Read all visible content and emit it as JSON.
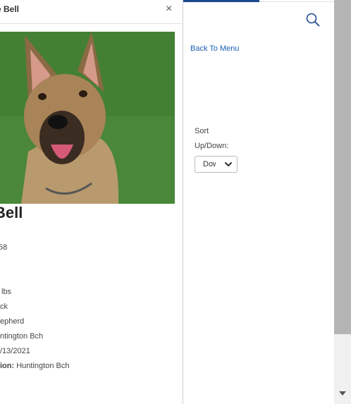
{
  "panel": {
    "title": "e Bell",
    "close_glyph": "×",
    "pet_name": "Bell",
    "id_value": "58",
    "details": [
      {
        "label": "",
        "value": "lbs"
      },
      {
        "label": "",
        "value": "ck"
      },
      {
        "label": "",
        "value": "epherd"
      },
      {
        "label": "",
        "value": "ntington Bch"
      },
      {
        "label": "",
        "value": "/13/2021"
      },
      {
        "label": "ion:",
        "value": "Huntington Bch"
      }
    ]
  },
  "sidebar": {
    "back_link": "Back To Menu",
    "sort_label_1": "Sort",
    "sort_label_2": "Up/Down:",
    "sort_value": "Down"
  },
  "icons": {
    "search": "search-icon",
    "close": "close-icon",
    "chevron": "chevron-down-icon",
    "scroll_down": "scroll-down-arrow-icon"
  },
  "colors": {
    "accent": "#1c4a8e",
    "link": "#1a5fb4"
  }
}
